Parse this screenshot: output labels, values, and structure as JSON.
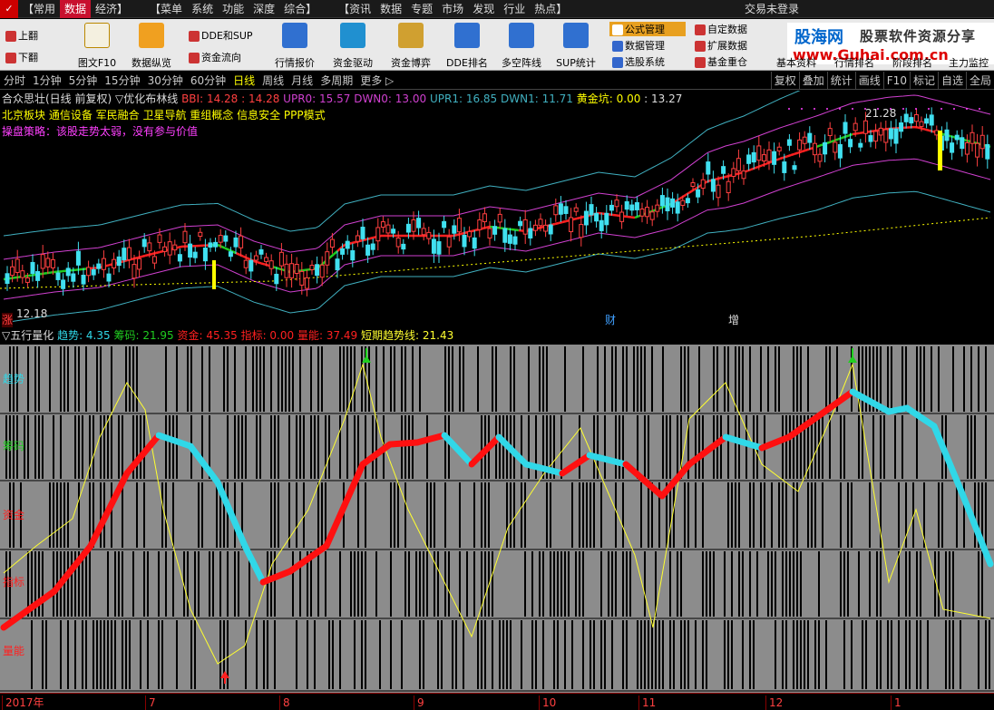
{
  "menu": {
    "items": [
      "【常用",
      "数据",
      "经济】",
      "【菜单",
      "系统",
      "功能",
      "深度",
      "综合】",
      "【资讯",
      "数据",
      "专题",
      "市场",
      "发现",
      "行业",
      "热点】"
    ],
    "active_index": 1,
    "trade_label": "交易未登录"
  },
  "watermark": {
    "brand": "股海网",
    "tagline": "股票软件资源分享",
    "url": "www.Guhai.com.cn"
  },
  "toolbar": {
    "page_up": "上翻",
    "page_down": "下翻",
    "f10": "图文F10",
    "vertical": "数据纵览",
    "dde_sup": "DDE和SUP",
    "fund_flow": "资金流向",
    "quote": "行情报价",
    "fund_drive": "资金驱动",
    "fund_game": "资金博弈",
    "dde_rank": "DDE排名",
    "longshort": "多空阵线",
    "sup_stats": "SUP统计",
    "formula_mgr": "公式管理",
    "data_mgr": "数据管理",
    "stock_select": "选股系统",
    "custom_data": "自定数据",
    "ext_data": "扩展数据",
    "fund_heavy": "基金重仓",
    "basic_info": "基本资料",
    "quote_rank": "行情排名",
    "stage_rank": "阶段排名",
    "main_monitor": "主力监控"
  },
  "periods": {
    "items": [
      "分时",
      "1分钟",
      "5分钟",
      "15分钟",
      "30分钟",
      "60分钟",
      "日线",
      "周线",
      "月线",
      "多周期",
      "更多 ▷"
    ],
    "selected_index": 6
  },
  "right_tools": [
    "复权",
    "叠加",
    "统计",
    "画线",
    "F10",
    "标记",
    "自选",
    "全局"
  ],
  "main_chart": {
    "title": "合众思壮(日线 前复权)",
    "indicator_name": "▽优化布林线",
    "bbi": "BBI: 14.28",
    "v1": ": 14.28",
    "upr0": "UPR0: 15.57",
    "dwn0": "DWN0: 13.00",
    "upr1": "UPR1: 16.85",
    "dwn1": "DWN1: 11.71",
    "gold_pit": "黄金坑: 0.00",
    "v2": ": 13.27",
    "concepts": "北京板块 通信设备 军民融合 卫星导航 重组概念 信息安全 PPP模式",
    "strategy": "操盘策略：该股走势太弱，没有参与价值",
    "high_label": "21.28",
    "low_label": "12.18",
    "mark_zhang": "涨",
    "mark_cai": "财",
    "mark_zeng": "增",
    "colors": {
      "bbi_up": "#ff2020",
      "bbi_dn": "#20cc20",
      "band0": "#d040d0",
      "band1": "#40b0c0",
      "gold": "#ffff00"
    }
  },
  "lower_chart": {
    "title": "▽五行量化",
    "trend": "趋势: 4.35",
    "chip": "筹码: 21.95",
    "fund": "资金: 45.35",
    "index": "指标: 0.00",
    "volume": "量能: 37.49",
    "short_trend": "短期趋势线: 21.43",
    "rows": [
      "趋势",
      "筹码",
      "资金",
      "指标",
      "量能"
    ],
    "row_colors": [
      "#30d8e8",
      "#20cc20",
      "#ff2020",
      "#ff2020",
      "#ff2020"
    ],
    "colors": {
      "rise": "#ff1010",
      "fall": "#30d8e8",
      "line": "#ffff30"
    }
  },
  "time_axis": {
    "labels": [
      "2017年",
      "7",
      "8",
      "9",
      "10",
      "11",
      "12",
      "1"
    ]
  }
}
